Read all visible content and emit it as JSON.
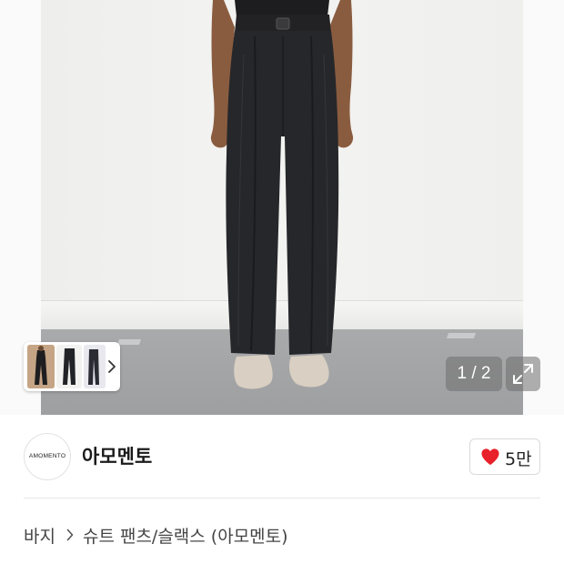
{
  "gallery": {
    "current_page": "1",
    "total_pages": "2",
    "separator": "/"
  },
  "brand": {
    "logo_text": "AMOMENTO",
    "name": "아모멘토"
  },
  "like": {
    "count": "5만",
    "color": "#e8202a"
  },
  "breadcrumb": {
    "items": [
      "바지",
      "슈트 팬츠/슬랙스 (아모멘토)"
    ]
  },
  "icons": {
    "thumb_next": "chevron-right-icon",
    "expand": "expand-arrows-icon",
    "like": "heart-icon",
    "breadcrumb_separator": "chevron-right-icon"
  }
}
